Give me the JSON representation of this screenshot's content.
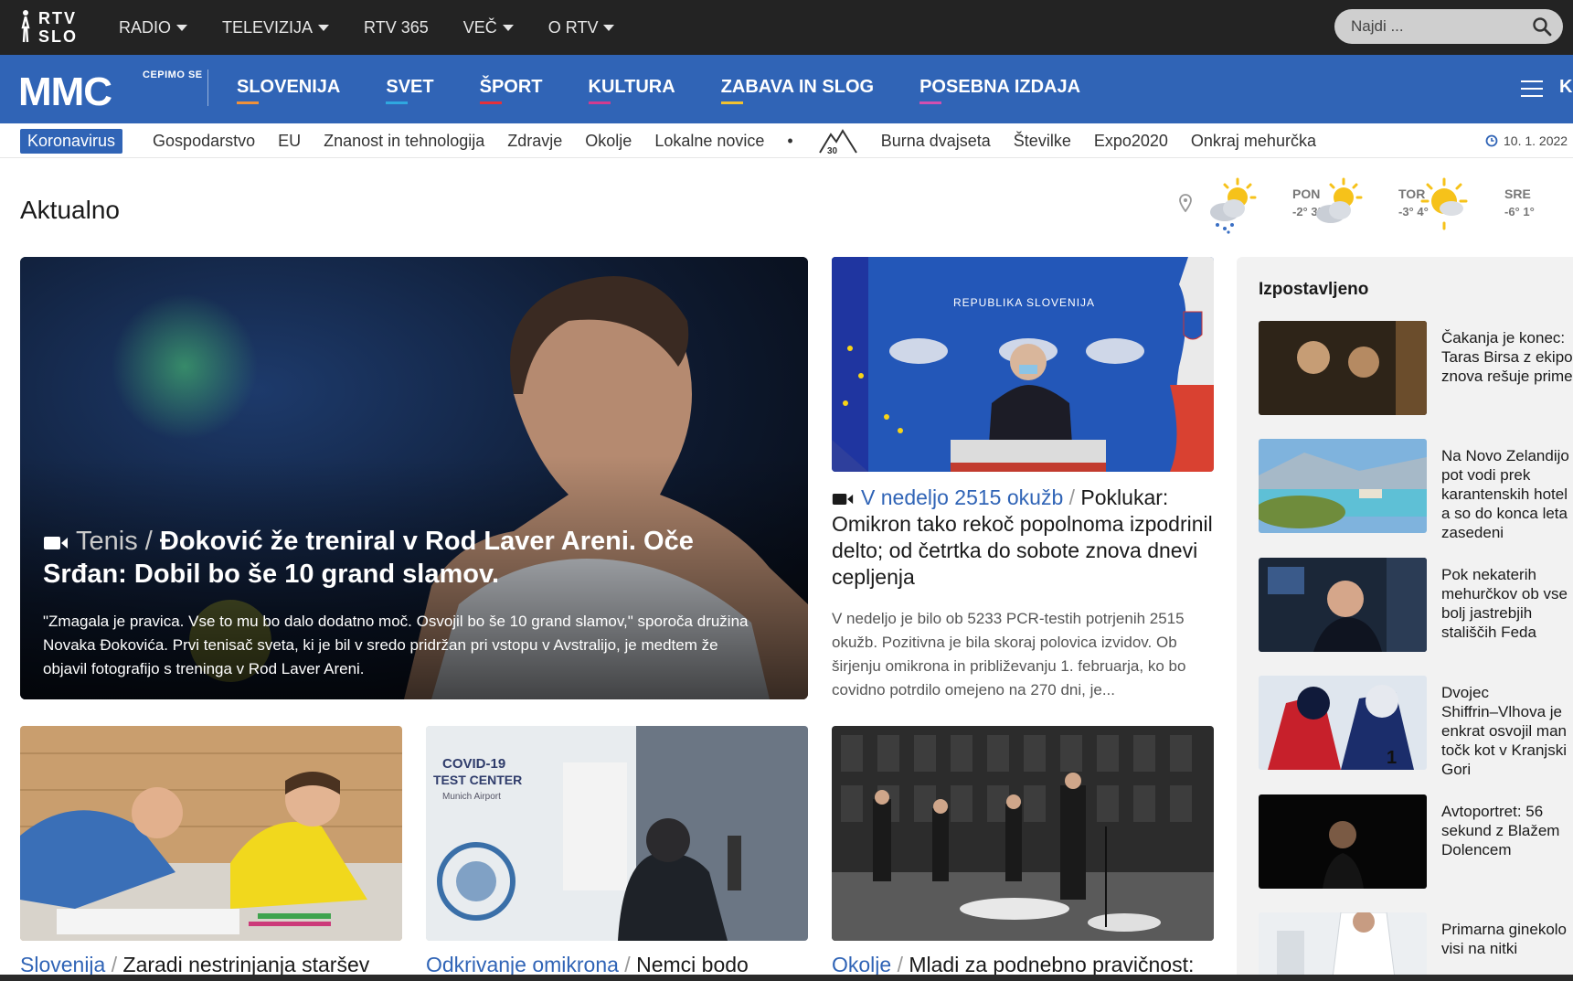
{
  "topbar": {
    "logo_line1": "RTV",
    "logo_line2": "SLO",
    "nav": [
      {
        "label": "RADIO",
        "dropdown": true
      },
      {
        "label": "TELEVIZIJA",
        "dropdown": true
      },
      {
        "label": "RTV 365",
        "dropdown": false
      },
      {
        "label": "VEČ",
        "dropdown": true
      },
      {
        "label": "O RTV",
        "dropdown": true
      }
    ],
    "search_placeholder": "Najdi ..."
  },
  "mmcbar": {
    "logo": "MMC",
    "tagline": "CEPIMO SE",
    "nav": [
      {
        "label": "SLOVENIJA",
        "color": "#f0913a"
      },
      {
        "label": "SVET",
        "color": "#2fa8e0"
      },
      {
        "label": "ŠPORT",
        "color": "#e5303a"
      },
      {
        "label": "KULTURA",
        "color": "#d23b8f"
      },
      {
        "label": "ZABAVA IN SLOG",
        "color": "#f2c230"
      },
      {
        "label": "POSEBNA IZDAJA",
        "color": "#d24fb0"
      }
    ],
    "cut_letter": "K"
  },
  "subnav": {
    "active": "Koronavirus",
    "items": [
      "Gospodarstvo",
      "EU",
      "Znanost in tehnologija",
      "Zdravje",
      "Okolje",
      "Lokalne novice"
    ],
    "dot": "•",
    "mountain_badge": "30",
    "items2": [
      "Burna dvajseta",
      "Številke",
      "Expo2020",
      "Onkraj mehurčka"
    ],
    "date": "10. 1. 2022"
  },
  "section_title": "Aktualno",
  "weather": [
    {
      "day": "PON",
      "temp": "-2° 3°",
      "icon": "sun-cloud-snow-icon"
    },
    {
      "day": "TOR",
      "temp": "-3° 4°",
      "icon": "sun-cloud-icon"
    },
    {
      "day": "SRE",
      "temp": "-6° 1°",
      "icon": "sun-small-cloud-icon"
    }
  ],
  "hero": {
    "section": "Tenis",
    "slash": " / ",
    "title": "Đoković že treniral v Rod Laver Areni. Oče Srđan: Dobil bo še 10 grand slamov.",
    "lead": "\"Zmagala je pravica. Vse to mu bo dalo dodatno moč. Osvojil bo še 10 grand slamov,\" sporoča družina Novaka Đokovića. Prvi tenisač sveta, ki je bil v sredo pridržan pri vstopu v Avstralijo, je medtem že objavil fotografijo s treninga v Rod Laver Areni."
  },
  "article2": {
    "section": "V nedeljo 2515 okužb",
    "slash": " / ",
    "title": "Poklukar: Omikron tako rekoč popolnoma izpodrinil delto; od četrtka do sobote znova dnevi cepljenja",
    "lead": "V nedeljo je bilo ob 5233 PCR-testih potrjenih 2515 okužb. Pozitivna je bila skoraj polovica izvidov. Ob širjenju omikrona in približevanju 1. februarja, ko bo covidno potrdilo omejeno na 270 dni, je...",
    "image_text": "REPUBLIKA SLOVENIJA"
  },
  "cards": [
    {
      "section": "Slovenija",
      "slash": " / ",
      "title": "Zaradi nestrinjanja staršev"
    },
    {
      "section": "Odkrivanje omikrona",
      "slash": " / ",
      "title": "Nemci bodo",
      "image_text1": "COVID-19",
      "image_text2": "TEST CENTER",
      "image_text3": "Munich Airport"
    },
    {
      "section": "Okolje",
      "slash": " / ",
      "title": "Mladi za podnebno pravičnost:"
    }
  ],
  "sidebar": {
    "title": "Izpostavljeno",
    "items": [
      {
        "lines": [
          "Čakanja je konec:",
          "Taras Birsa z ekipo",
          "znova rešuje prime"
        ]
      },
      {
        "lines": [
          "Na Novo Zelandijo",
          "pot vodi prek",
          "karantenskih hotel",
          "a so do konca leta",
          "zasedeni"
        ]
      },
      {
        "lines": [
          "Pok nekaterih",
          "mehurčkov ob vse",
          "bolj jastrebjih",
          "stališčih Feda"
        ]
      },
      {
        "lines": [
          "Dvojec",
          "Shiffrin–Vlhova je",
          "enkrat osvojil man",
          "točk kot v Kranjski",
          "Gori"
        ]
      },
      {
        "lines": [
          "Avtoportret: 56",
          "sekund z Blažem",
          "Dolencem"
        ]
      },
      {
        "lines": [
          "Primarna ginekolo",
          "visi na nitki"
        ]
      }
    ]
  },
  "colors": {
    "brand_blue": "#3064b6",
    "topbar": "#232323"
  }
}
